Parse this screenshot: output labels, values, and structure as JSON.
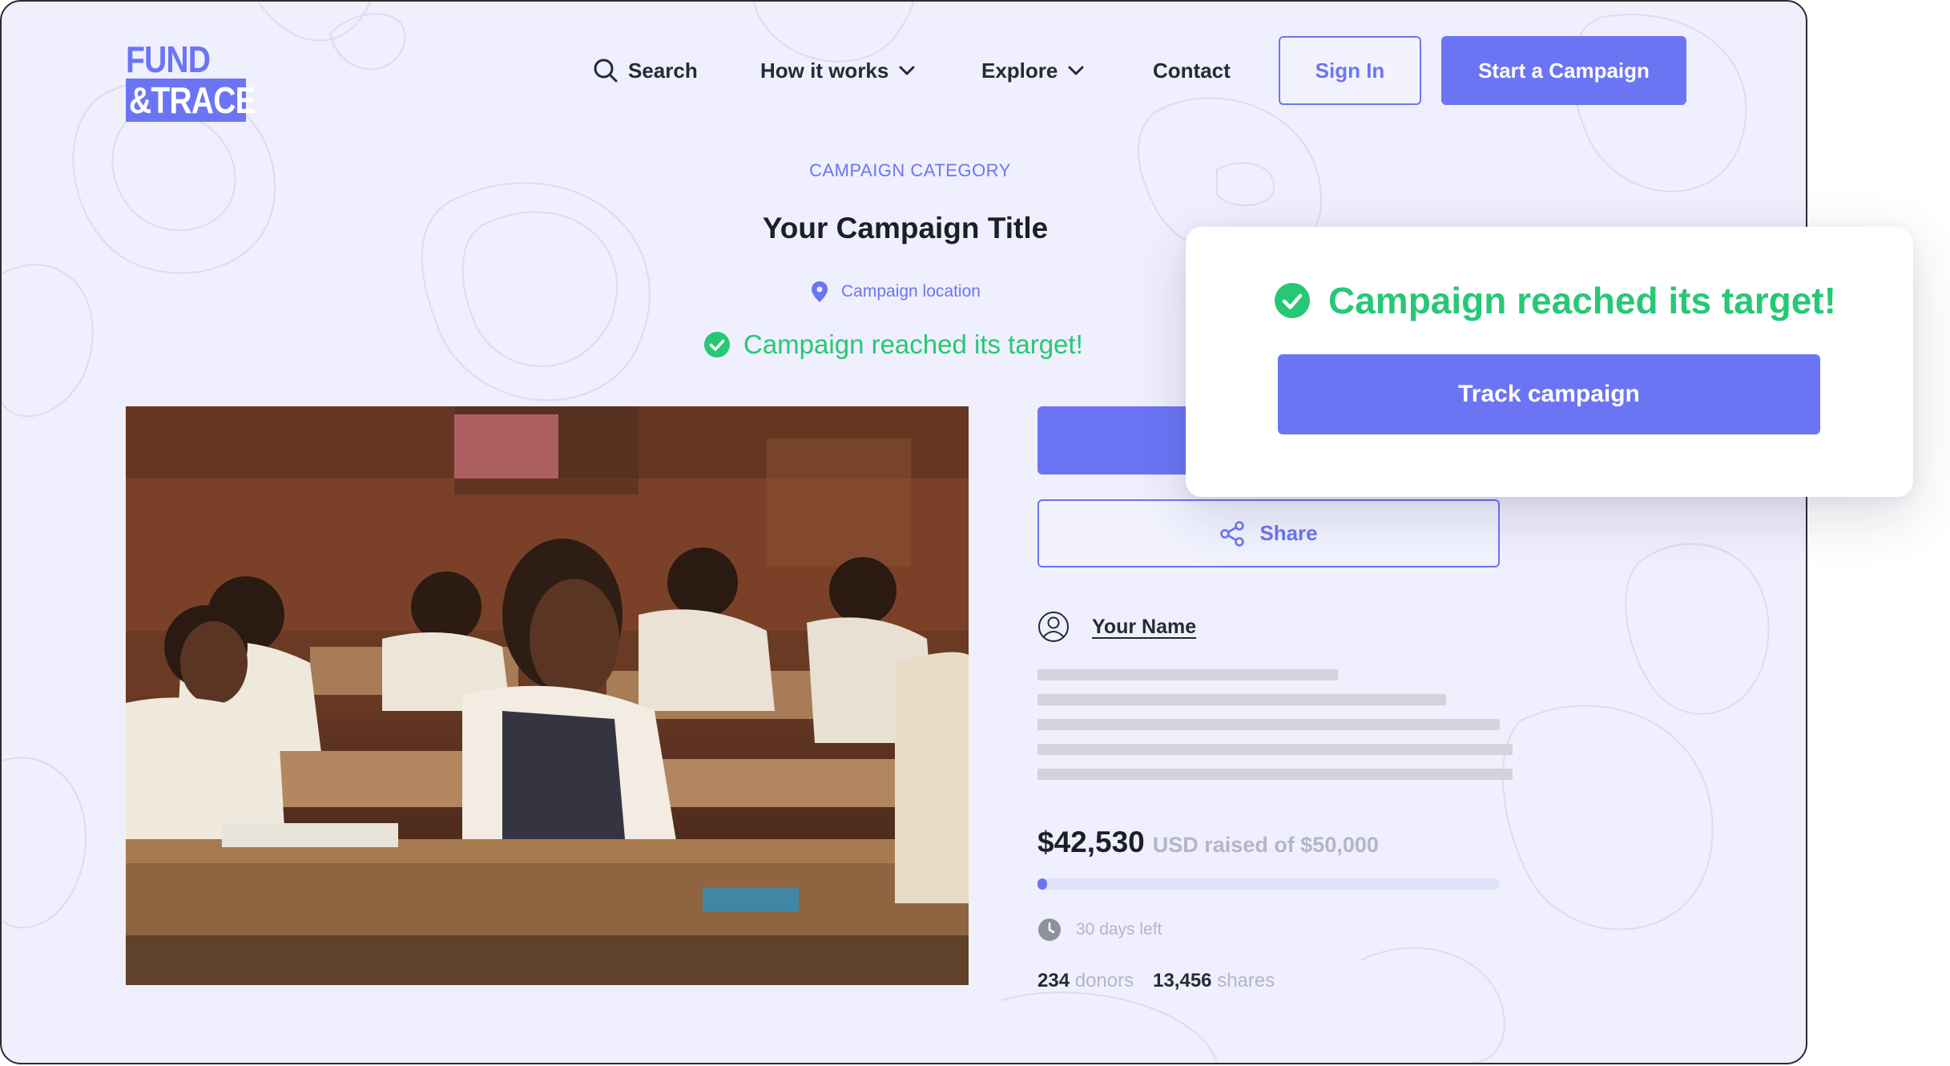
{
  "brand": {
    "logo_line1": "FUND",
    "logo_line2": "&TRACE",
    "accent_color": "#6b75f4",
    "success_color": "#26c876"
  },
  "nav": {
    "search_label": "Search",
    "how_it_works_label": "How it works",
    "explore_label": "Explore",
    "contact_label": "Contact",
    "sign_in_label": "Sign In",
    "start_campaign_label": "Start a Campaign"
  },
  "campaign": {
    "category": "CAMPAIGN CATEGORY",
    "title": "Your Campaign Title",
    "location": "Campaign location",
    "status": "Campaign reached its target!",
    "photo_description_icon": "classroom-photo"
  },
  "actions": {
    "share_label": "Share"
  },
  "author": {
    "name": "Your Name"
  },
  "funding": {
    "amount_raised": "$42,530",
    "raised_of_text": "USD raised of $50,000",
    "progress_fraction": 0.02,
    "days_left": "30 days left",
    "donors_count": "234",
    "donors_label": "donors",
    "shares_count": "13,456",
    "shares_label": "shares"
  },
  "overlay": {
    "status": "Campaign reached its target!",
    "track_label": "Track campaign"
  }
}
